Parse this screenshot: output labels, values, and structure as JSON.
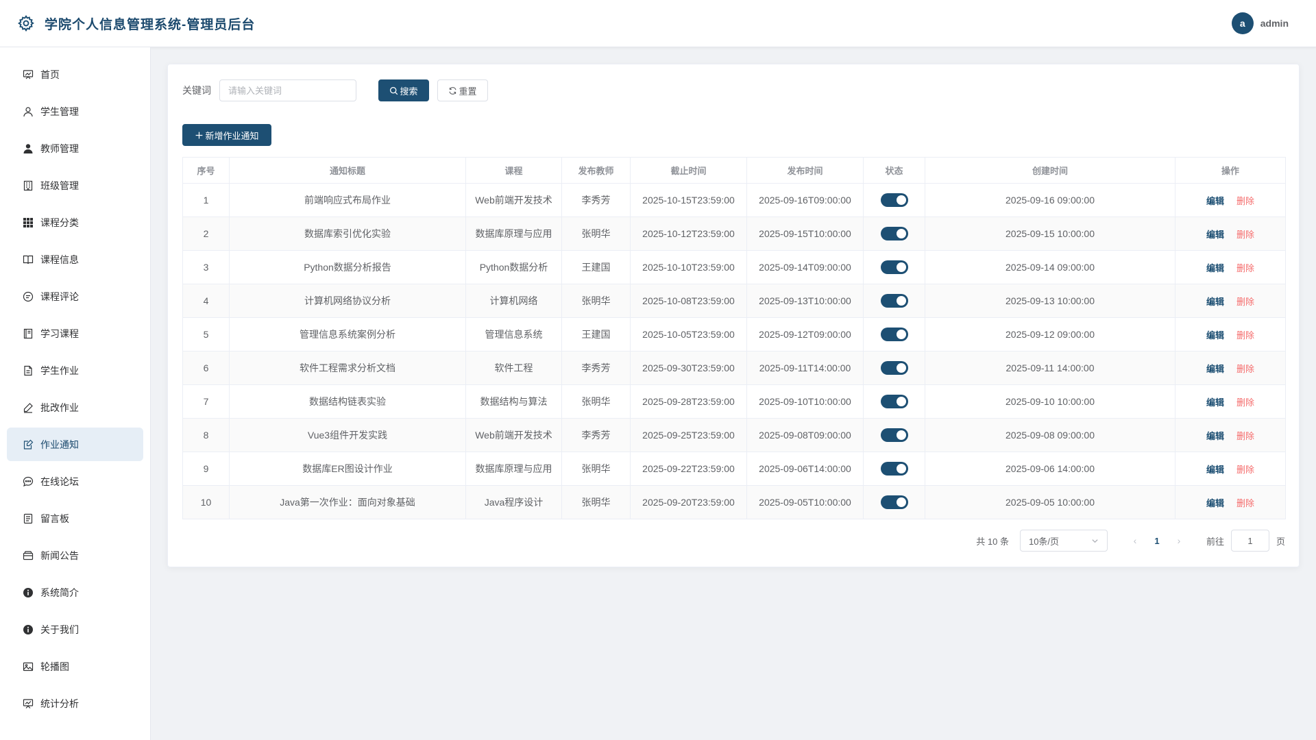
{
  "header": {
    "title": "学院个人信息管理系统-管理员后台",
    "avatar_letter": "a",
    "username": "admin"
  },
  "sidebar": {
    "items": [
      {
        "label": "首页",
        "icon": "dashboard-icon"
      },
      {
        "label": "学生管理",
        "icon": "user-icon"
      },
      {
        "label": "教师管理",
        "icon": "user-filled-icon"
      },
      {
        "label": "班级管理",
        "icon": "building-icon"
      },
      {
        "label": "课程分类",
        "icon": "grid-icon"
      },
      {
        "label": "课程信息",
        "icon": "book-icon"
      },
      {
        "label": "课程评论",
        "icon": "comment-icon"
      },
      {
        "label": "学习课程",
        "icon": "notebook-icon"
      },
      {
        "label": "学生作业",
        "icon": "document-icon"
      },
      {
        "label": "批改作业",
        "icon": "edit-pen-icon"
      },
      {
        "label": "作业通知",
        "icon": "notice-edit-icon",
        "active": true
      },
      {
        "label": "在线论坛",
        "icon": "chat-dots-icon"
      },
      {
        "label": "留言板",
        "icon": "memo-icon"
      },
      {
        "label": "新闻公告",
        "icon": "wallet-icon"
      },
      {
        "label": "系统简介",
        "icon": "info-filled-icon"
      },
      {
        "label": "关于我们",
        "icon": "info-filled-icon"
      },
      {
        "label": "轮播图",
        "icon": "picture-icon"
      },
      {
        "label": "统计分析",
        "icon": "chart-board-icon"
      }
    ]
  },
  "search": {
    "label": "关键词",
    "placeholder": "请输入关键词",
    "value": "",
    "search_label": "搜索",
    "reset_label": "重置"
  },
  "toolbar": {
    "add_label": "新增作业通知"
  },
  "table": {
    "columns": [
      "序号",
      "通知标题",
      "课程",
      "发布教师",
      "截止时间",
      "发布时间",
      "状态",
      "创建时间",
      "操作"
    ],
    "edit_label": "编辑",
    "delete_label": "删除",
    "rows": [
      {
        "no": "1",
        "title": "前端响应式布局作业",
        "course": "Web前端开发技术",
        "teacher": "李秀芳",
        "deadline": "2025-10-15T23:59:00",
        "publish": "2025-09-16T09:00:00",
        "status": true,
        "created": "2025-09-16 09:00:00"
      },
      {
        "no": "2",
        "title": "数据库索引优化实验",
        "course": "数据库原理与应用",
        "teacher": "张明华",
        "deadline": "2025-10-12T23:59:00",
        "publish": "2025-09-15T10:00:00",
        "status": true,
        "created": "2025-09-15 10:00:00"
      },
      {
        "no": "3",
        "title": "Python数据分析报告",
        "course": "Python数据分析",
        "teacher": "王建国",
        "deadline": "2025-10-10T23:59:00",
        "publish": "2025-09-14T09:00:00",
        "status": true,
        "created": "2025-09-14 09:00:00"
      },
      {
        "no": "4",
        "title": "计算机网络协议分析",
        "course": "计算机网络",
        "teacher": "张明华",
        "deadline": "2025-10-08T23:59:00",
        "publish": "2025-09-13T10:00:00",
        "status": true,
        "created": "2025-09-13 10:00:00"
      },
      {
        "no": "5",
        "title": "管理信息系统案例分析",
        "course": "管理信息系统",
        "teacher": "王建国",
        "deadline": "2025-10-05T23:59:00",
        "publish": "2025-09-12T09:00:00",
        "status": true,
        "created": "2025-09-12 09:00:00"
      },
      {
        "no": "6",
        "title": "软件工程需求分析文档",
        "course": "软件工程",
        "teacher": "李秀芳",
        "deadline": "2025-09-30T23:59:00",
        "publish": "2025-09-11T14:00:00",
        "status": true,
        "created": "2025-09-11 14:00:00"
      },
      {
        "no": "7",
        "title": "数据结构链表实验",
        "course": "数据结构与算法",
        "teacher": "张明华",
        "deadline": "2025-09-28T23:59:00",
        "publish": "2025-09-10T10:00:00",
        "status": true,
        "created": "2025-09-10 10:00:00"
      },
      {
        "no": "8",
        "title": "Vue3组件开发实践",
        "course": "Web前端开发技术",
        "teacher": "李秀芳",
        "deadline": "2025-09-25T23:59:00",
        "publish": "2025-09-08T09:00:00",
        "status": true,
        "created": "2025-09-08 09:00:00"
      },
      {
        "no": "9",
        "title": "数据库ER图设计作业",
        "course": "数据库原理与应用",
        "teacher": "张明华",
        "deadline": "2025-09-22T23:59:00",
        "publish": "2025-09-06T14:00:00",
        "status": true,
        "created": "2025-09-06 14:00:00"
      },
      {
        "no": "10",
        "title": "Java第一次作业：面向对象基础",
        "course": "Java程序设计",
        "teacher": "张明华",
        "deadline": "2025-09-20T23:59:00",
        "publish": "2025-09-05T10:00:00",
        "status": true,
        "created": "2025-09-05 10:00:00"
      }
    ]
  },
  "pagination": {
    "total_text": "共 10 条",
    "page_size": "10条/页",
    "current_page": "1",
    "goto_label": "前往",
    "goto_value": "1",
    "page_suffix": "页"
  },
  "colors": {
    "primary": "#1d4f73",
    "danger": "#f56c6c",
    "active_bg": "#e6eef6"
  }
}
